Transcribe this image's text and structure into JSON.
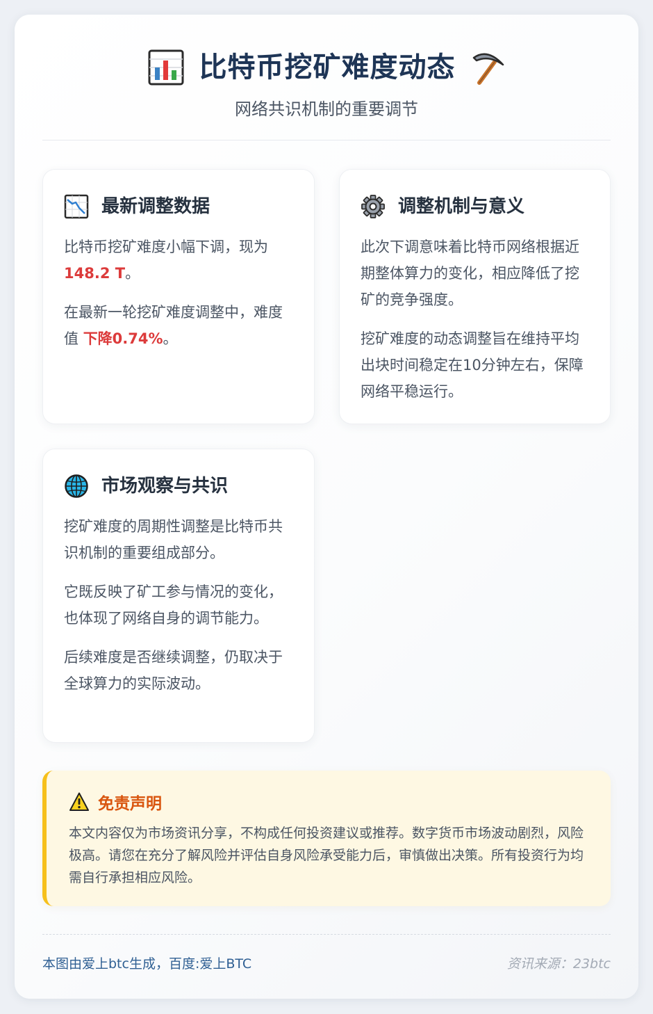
{
  "header": {
    "title": "比特币挖矿难度动态",
    "title_left_icon": "bar-chart-icon",
    "title_right_icon": "pickaxe-icon",
    "subtitle": "网络共识机制的重要调节"
  },
  "cards": [
    {
      "icon": "chart-decreasing-icon",
      "title": "最新调整数据",
      "p1_text": "比特币挖矿难度小幅下调，现为",
      "p1_highlight": "148.2 T",
      "p1_end": "。",
      "p2_text": "在最新一轮挖矿难度调整中，难度值",
      "p2_highlight": "下降0.74%",
      "p2_end": "。"
    },
    {
      "icon": "gear-icon",
      "title": "调整机制与意义",
      "p1": "此次下调意味着比特币网络根据近期整体算力的变化，相应降低了挖矿的竞争强度。",
      "p2": "挖矿难度的动态调整旨在维持平均出块时间稳定在10分钟左右，保障网络平稳运行。"
    },
    {
      "icon": "globe-icon",
      "title": "市场观察与共识",
      "p1": "挖矿难度的周期性调整是比特币共识机制的重要组成部分。",
      "p2": "它既反映了矿工参与情况的变化，也体现了网络自身的调节能力。",
      "p3": "后续难度是否继续调整，仍取决于全球算力的实际波动。"
    }
  ],
  "disclaimer": {
    "icon": "warning-icon",
    "title": "免责声明",
    "text": "本文内容仅为市场资讯分享，不构成任何投资建议或推荐。数字货币市场波动剧烈，风险极高。请您在充分了解风险并评估自身风险承受能力后，审慎做出决策。所有投资行为均需自行承担相应风险。"
  },
  "footer": {
    "left": "本图由爱上btc生成，百度:爱上BTC",
    "right": "资讯来源：23btc"
  },
  "colors": {
    "title": "#1e3556",
    "highlight": "#dc3b3b",
    "disclaimer_accent": "#f6c01c",
    "disclaimer_title": "#d9560f",
    "footer_link": "#2f5f93"
  }
}
